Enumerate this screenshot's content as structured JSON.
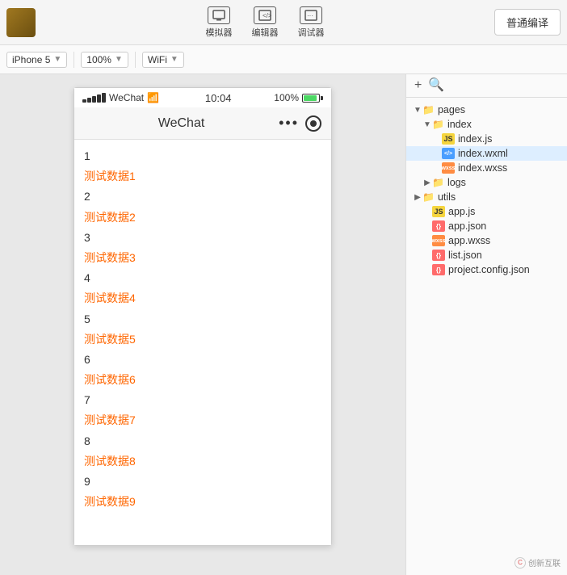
{
  "toolbar": {
    "simulator_label": "模拟器",
    "editor_label": "编辑器",
    "debugger_label": "调试器",
    "compile_label": "普通编译"
  },
  "device_bar": {
    "device": "iPhone 5",
    "zoom": "100%",
    "network": "WiFi"
  },
  "phone": {
    "status_bar": {
      "carrier": "WeChat",
      "time": "10:04",
      "battery_pct": "100%"
    },
    "header": {
      "title": "WeChat"
    },
    "list": [
      {
        "number": "1",
        "data": "测试数据1"
      },
      {
        "number": "2",
        "data": "测试数据2"
      },
      {
        "number": "3",
        "data": "测试数据3"
      },
      {
        "number": "4",
        "data": "测试数据4"
      },
      {
        "number": "5",
        "data": "测试数据5"
      },
      {
        "number": "6",
        "data": "测试数据6"
      },
      {
        "number": "7",
        "data": "测试数据7"
      },
      {
        "number": "8",
        "data": "测试数据8"
      },
      {
        "number": "9",
        "data": "测试数据9"
      }
    ]
  },
  "file_tree": {
    "items": [
      {
        "id": "pages",
        "label": "pages",
        "type": "folder",
        "indent": 0,
        "arrow": "▼"
      },
      {
        "id": "index",
        "label": "index",
        "type": "folder",
        "indent": 1,
        "arrow": "▼"
      },
      {
        "id": "index_js",
        "label": "index.js",
        "type": "js",
        "indent": 2,
        "arrow": ""
      },
      {
        "id": "index_wxml",
        "label": "index.wxml",
        "type": "wxml",
        "indent": 2,
        "arrow": "",
        "active": true
      },
      {
        "id": "index_wxss",
        "label": "index.wxss",
        "type": "wxss",
        "indent": 2,
        "arrow": ""
      },
      {
        "id": "logs",
        "label": "logs",
        "type": "folder",
        "indent": 1,
        "arrow": "▶"
      },
      {
        "id": "utils",
        "label": "utils",
        "type": "folder",
        "indent": 0,
        "arrow": "▶"
      },
      {
        "id": "app_js",
        "label": "app.js",
        "type": "js",
        "indent": 1,
        "arrow": ""
      },
      {
        "id": "app_json",
        "label": "app.json",
        "type": "json",
        "indent": 1,
        "arrow": ""
      },
      {
        "id": "app_wxss",
        "label": "app.wxss",
        "type": "wxss",
        "indent": 1,
        "arrow": ""
      },
      {
        "id": "list_json",
        "label": "list.json",
        "type": "json",
        "indent": 1,
        "arrow": ""
      },
      {
        "id": "project_config",
        "label": "project.config.json",
        "type": "json",
        "indent": 1,
        "arrow": ""
      }
    ]
  },
  "watermark": {
    "text": "创新互联"
  }
}
